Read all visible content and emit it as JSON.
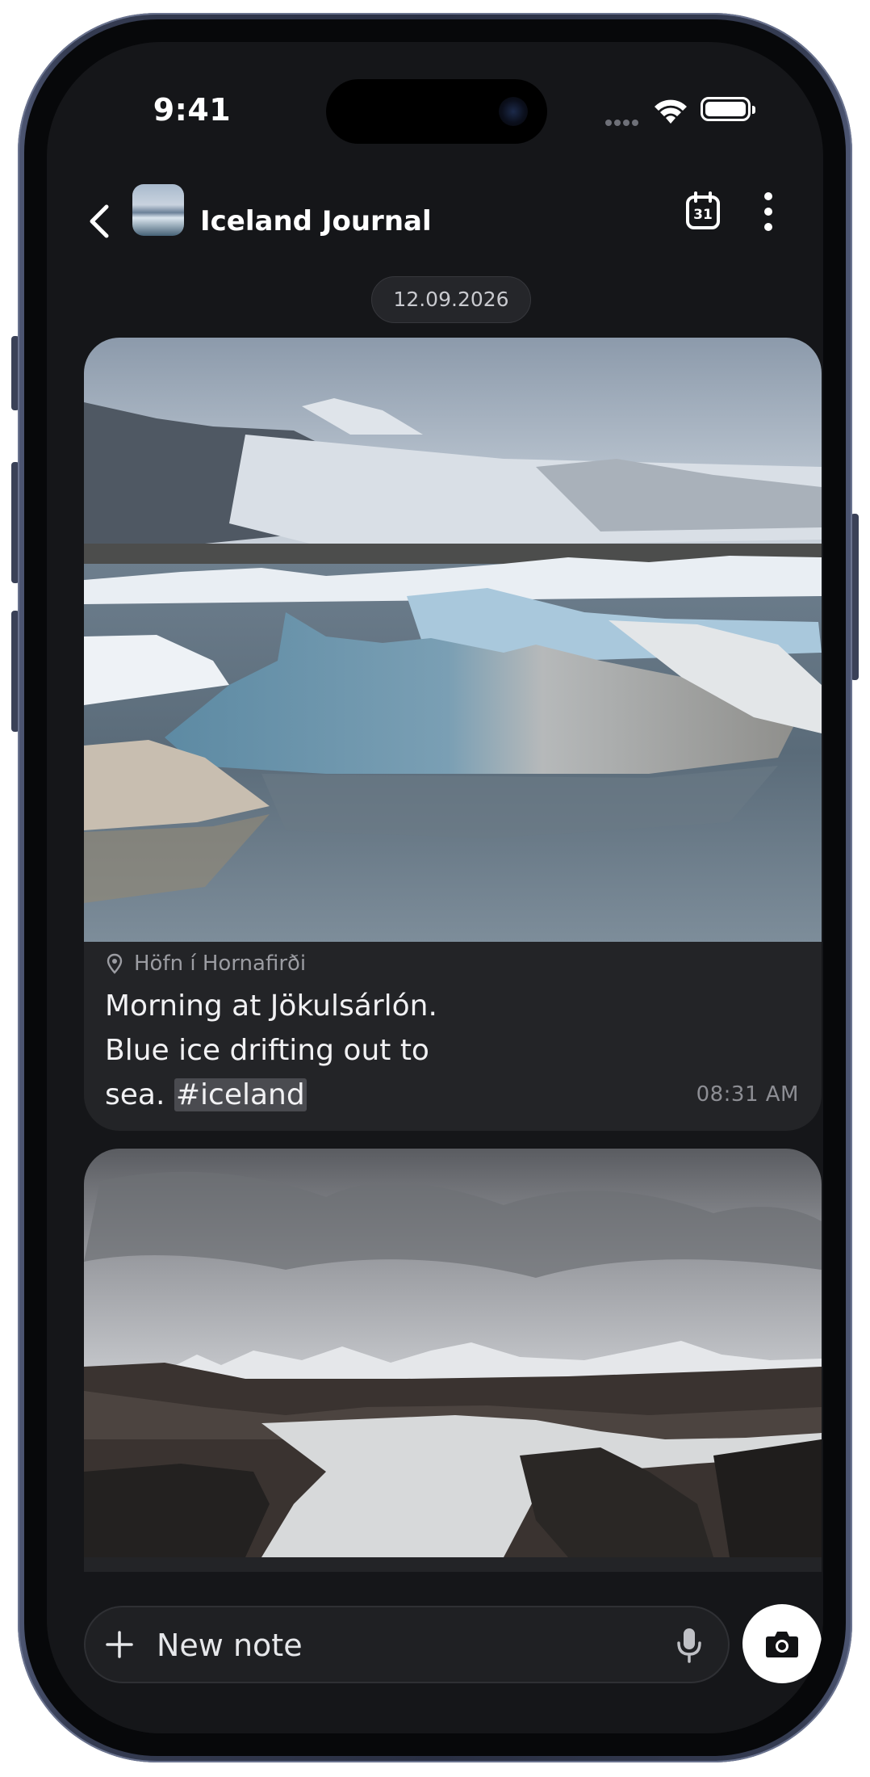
{
  "status_bar": {
    "time": "9:41",
    "icons": [
      "signal-dots-icon",
      "wifi-icon",
      "battery-icon"
    ]
  },
  "header": {
    "back_icon": "chevron-left-icon",
    "title": "Iceland Journal",
    "calendar_day": "31",
    "calendar_icon": "calendar-icon",
    "more_icon": "vertical-dots-icon"
  },
  "feed": {
    "date_chip": "12.09.2026",
    "entries": [
      {
        "photo": "glacier-lagoon-icebergs",
        "location": "Höfn í Hornafirði",
        "caption_line1": "Morning at Jökulsárlón.",
        "caption_line2": "Blue ice drifting out to",
        "caption_line3_prefix": "sea. ",
        "hashtag": "#iceland",
        "time": "08:31 AM"
      },
      {
        "photo": "highland-river-waterfall"
      }
    ]
  },
  "composer": {
    "add_icon": "plus-icon",
    "placeholder": "New note",
    "mic_icon": "microphone-icon",
    "camera_icon": "camera-icon"
  },
  "colors": {
    "background": "#151619",
    "card": "#232427",
    "text": "#f1f1f3",
    "muted": "#8d8e94",
    "frame": "#2a3044"
  }
}
